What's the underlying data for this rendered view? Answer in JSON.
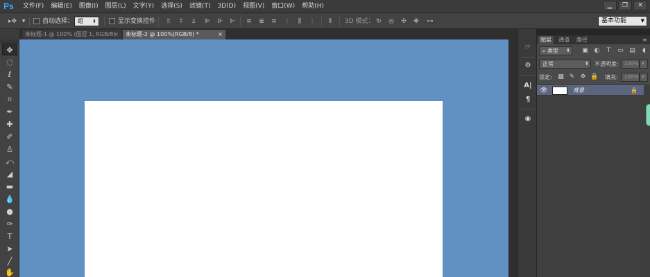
{
  "app": {
    "logo": "Ps"
  },
  "menu": [
    "文件(F)",
    "编辑(E)",
    "图像(I)",
    "图层(L)",
    "文字(Y)",
    "选择(S)",
    "滤镜(T)",
    "3D(D)",
    "视图(V)",
    "窗口(W)",
    "帮助(H)"
  ],
  "window_controls": {
    "minimize": "▁",
    "restore": "❐",
    "close": "✕"
  },
  "options_bar": {
    "auto_select_label": "自动选择：",
    "auto_select_value": "组",
    "show_transform_label": "显示变换控件",
    "mode_3d_label": "3D 模式：",
    "workspace": "基本功能"
  },
  "tabs": [
    {
      "label": "未标题-1 @ 100% (图层 1, RGB/8)",
      "close": "×"
    },
    {
      "label": "未标题-2 @ 100%(RGB/8) *",
      "close": "×"
    }
  ],
  "tools": [
    "move-tool",
    "marquee-tool",
    "lasso-tool",
    "quick-select-tool",
    "crop-tool",
    "eyedropper-tool",
    "healing-tool",
    "brush-tool",
    "stamp-tool",
    "history-brush-tool",
    "eraser-tool",
    "gradient-tool",
    "blur-tool",
    "dodge-tool",
    "pen-tool",
    "type-tool",
    "path-select-tool",
    "line-tool",
    "hand-tool"
  ],
  "tool_type_glyph": "T",
  "dock_glyphs": {
    "character": "A|",
    "paragraph": "¶",
    "history": "☞"
  },
  "layers_panel": {
    "tabs": [
      "图层",
      "通道",
      "路径"
    ],
    "filter_label": "类型",
    "blend_mode": "正常",
    "opacity_label": "不透明度:",
    "opacity_value": "100%",
    "lock_label": "锁定:",
    "fill_label": "填充:",
    "fill_value": "100%",
    "filter_glyph": "T",
    "layer": {
      "name": "背景"
    }
  },
  "colors": {
    "canvas_bg": "#6190c2",
    "document": "#ffffff",
    "ui_dark": "#3c3c3c",
    "selected_layer": "#5d6680",
    "logo_blue": "#31a8ff"
  }
}
